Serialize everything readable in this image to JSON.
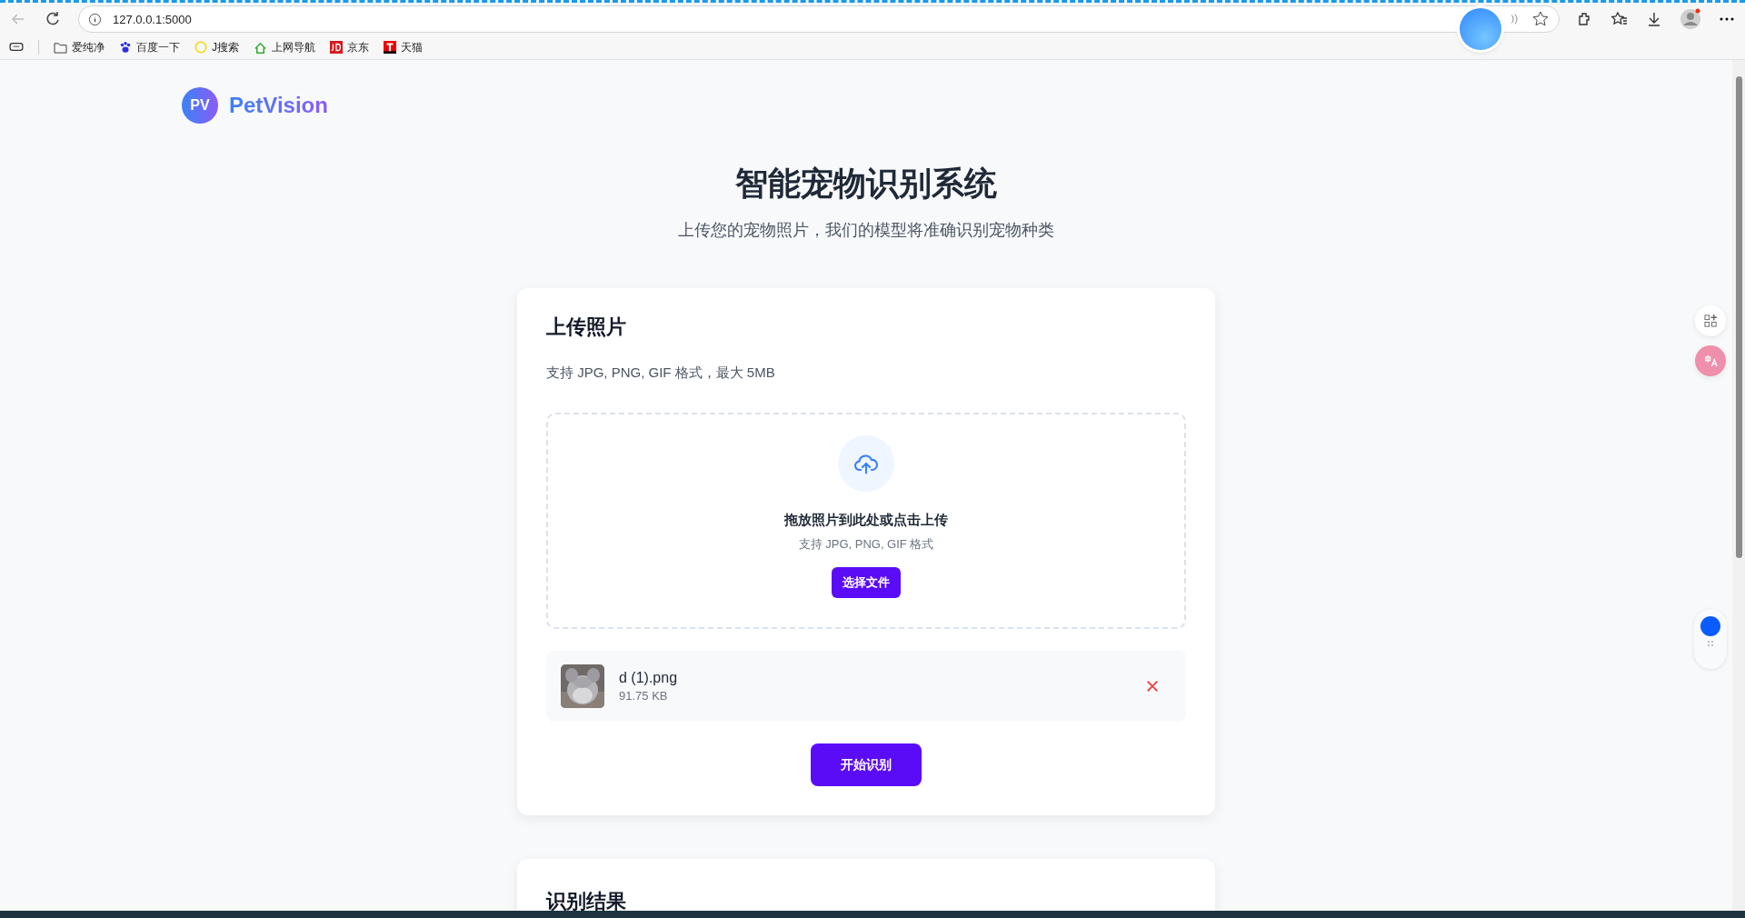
{
  "browser": {
    "url": "127.0.0.1:5000",
    "bookmarks": [
      {
        "label": "爱纯净",
        "kind": "folder"
      },
      {
        "label": "百度一下",
        "kind": "paw"
      },
      {
        "label": "J搜索",
        "kind": "j"
      },
      {
        "label": "上网导航",
        "kind": "house"
      },
      {
        "label": "京东",
        "kind": "jd"
      },
      {
        "label": "天猫",
        "kind": "tmall"
      }
    ]
  },
  "logo": {
    "mark": "PV",
    "name": "PetVision"
  },
  "hero": {
    "title": "智能宠物识别系统",
    "subtitle": "上传您的宠物照片，我们的模型将准确识别宠物种类"
  },
  "upload_card": {
    "title": "上传照片",
    "hint": "支持 JPG, PNG, GIF 格式，最大 5MB",
    "dropzone": {
      "prompt": "拖放照片到此处或点击上传",
      "formats": "支持 JPG, PNG, GIF 格式",
      "button": "选择文件"
    },
    "file": {
      "name": "d (1).png",
      "size": "91.75 KB"
    },
    "submit": "开始识别"
  },
  "result_card": {
    "title": "识别结果"
  }
}
